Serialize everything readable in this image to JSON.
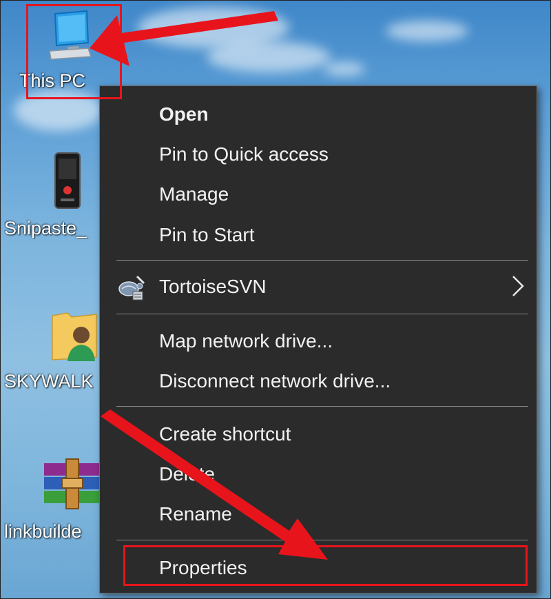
{
  "desktop": {
    "icons": [
      {
        "label": "This PC",
        "icon": "monitor-icon"
      },
      {
        "label": "Snipaste_",
        "icon": "phone-screenshot-icon"
      },
      {
        "label": "SKYWALK",
        "icon": "user-folder-icon"
      },
      {
        "label": "linkbuilde",
        "icon": "winrar-archive-icon"
      }
    ]
  },
  "context_menu": {
    "items": [
      {
        "label": "Open",
        "bold": true
      },
      {
        "label": "Pin to Quick access"
      },
      {
        "label": "Manage"
      },
      {
        "label": "Pin to Start"
      },
      {
        "label": "TortoiseSVN",
        "icon": "tortoisesvn-icon",
        "submenu": true
      },
      {
        "label": "Map network drive..."
      },
      {
        "label": "Disconnect network drive..."
      },
      {
        "label": "Create shortcut"
      },
      {
        "label": "Delete"
      },
      {
        "label": "Rename"
      },
      {
        "label": "Properties",
        "highlighted": true
      }
    ]
  },
  "annotations": {
    "color": "#e8141c"
  }
}
